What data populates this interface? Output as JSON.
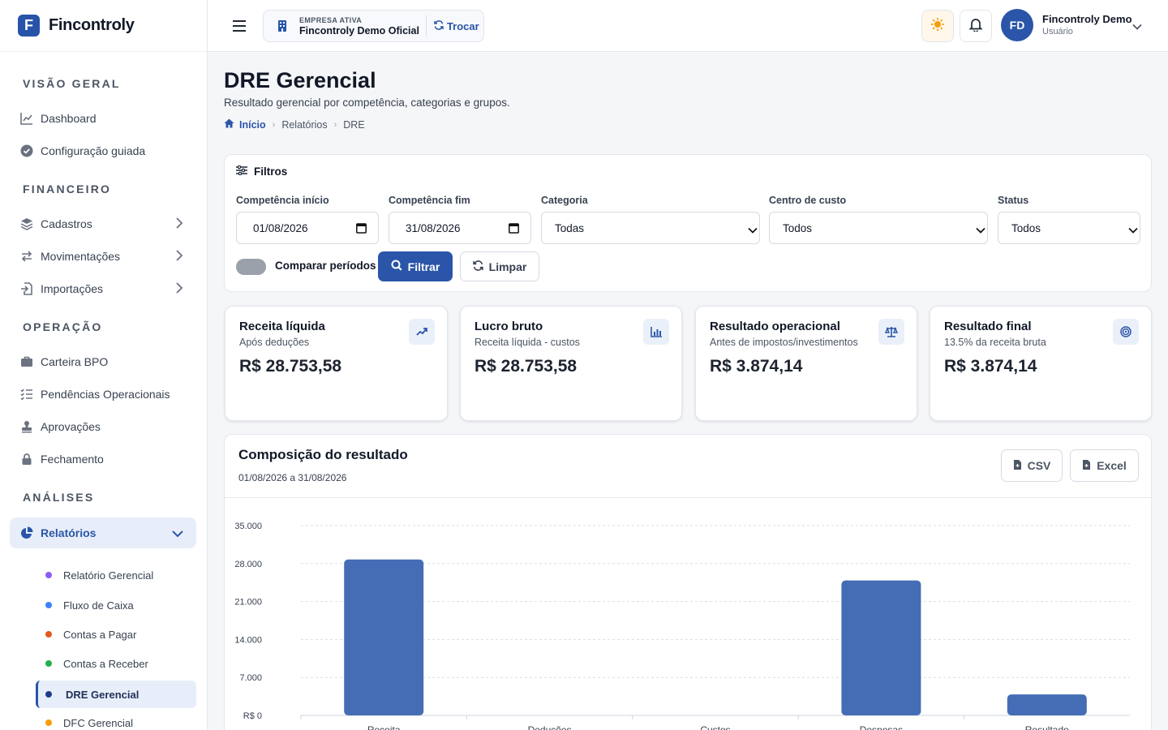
{
  "brand": {
    "name": "Fincontroly",
    "logo_letter": "F"
  },
  "sidebar": {
    "sections": [
      {
        "title": "VISÃO GERAL",
        "items": [
          {
            "label": "Dashboard",
            "icon": "chart-line-icon"
          },
          {
            "label": "Configuração guiada",
            "icon": "check-circle-icon"
          }
        ]
      },
      {
        "title": "FINANCEIRO",
        "items": [
          {
            "label": "Cadastros",
            "icon": "layers-icon"
          },
          {
            "label": "Movimentações",
            "icon": "arrows-swap-icon"
          },
          {
            "label": "Importações",
            "icon": "file-import-icon"
          }
        ]
      },
      {
        "title": "OPERAÇÃO",
        "items": [
          {
            "label": "Carteira BPO",
            "icon": "briefcase-icon"
          },
          {
            "label": "Pendências Operacionais",
            "icon": "list-check-icon"
          },
          {
            "label": "Aprovações",
            "icon": "stamp-icon"
          },
          {
            "label": "Fechamento",
            "icon": "lock-icon"
          }
        ]
      },
      {
        "title": "ANÁLISES",
        "items": [
          {
            "label": "Relatórios",
            "icon": "pie-chart-icon"
          }
        ]
      }
    ],
    "reports_sub": [
      {
        "label": "Relatório Gerencial",
        "color": "#8b5cf6"
      },
      {
        "label": "Fluxo de Caixa",
        "color": "#3b82f6"
      },
      {
        "label": "Contas a Pagar",
        "color": "#e25a1c"
      },
      {
        "label": "Contas a Receber",
        "color": "#22b14c"
      },
      {
        "label": "DRE Gerencial",
        "color": "#1e3a8a"
      },
      {
        "label": "DFC Gerencial",
        "color": "#f59e0b"
      }
    ]
  },
  "topbar": {
    "company_label": "EMPRESA ATIVA",
    "company_name": "Fincontroly Demo Oficial",
    "swap_label": "Trocar",
    "user_initials": "FD",
    "user_name": "Fincontroly Demo",
    "user_role": "Usuário"
  },
  "page": {
    "title": "DRE Gerencial",
    "subtitle": "Resultado gerencial por competência, categorias e grupos.",
    "breadcrumb": [
      "Início",
      "Relatórios",
      "DRE"
    ]
  },
  "filters": {
    "title": "Filtros",
    "start_label": "Competência início",
    "start_value": "01/08/2026",
    "end_label": "Competência fim",
    "end_value": "31/08/2026",
    "category_label": "Categoria",
    "category_value": "Todas",
    "cost_center_label": "Centro de custo",
    "cost_center_value": "Todos",
    "status_label": "Status",
    "status_value": "Todos",
    "compare_label": "Comparar períodos",
    "compare_on": false,
    "filter_button": "Filtrar",
    "clear_button": "Limpar"
  },
  "kpis": [
    {
      "title": "Receita líquida",
      "subtitle": "Após deduções",
      "value": "R$ 28.753,58",
      "icon": "trend-up-icon"
    },
    {
      "title": "Lucro bruto",
      "subtitle": "Receita líquida - custos",
      "value": "R$ 28.753,58",
      "icon": "bar-chart-icon"
    },
    {
      "title": "Resultado operacional",
      "subtitle": "Antes de impostos/investimentos",
      "value": "R$ 3.874,14",
      "icon": "scale-icon"
    },
    {
      "title": "Resultado final",
      "subtitle": "13.5% da receita bruta",
      "value": "R$ 3.874,14",
      "icon": "target-icon"
    }
  ],
  "result": {
    "title": "Composição do resultado",
    "period": "01/08/2026 a 31/08/2026",
    "csv_button": "CSV",
    "excel_button": "Excel"
  },
  "colors": {
    "accent": "#2a55a8",
    "bar": "#446db5"
  },
  "chart_data": {
    "type": "bar",
    "categories": [
      "Receita",
      "Deduções",
      "Custos",
      "Despesas",
      "Resultado"
    ],
    "values": [
      28753.58,
      0,
      0,
      24879.44,
      3874.14
    ],
    "ylim": [
      0,
      35000
    ],
    "yticks": [
      "R$ 0",
      "7.000",
      "14.000",
      "21.000",
      "28.000",
      "35.000"
    ],
    "grid": true,
    "legend": "none"
  }
}
